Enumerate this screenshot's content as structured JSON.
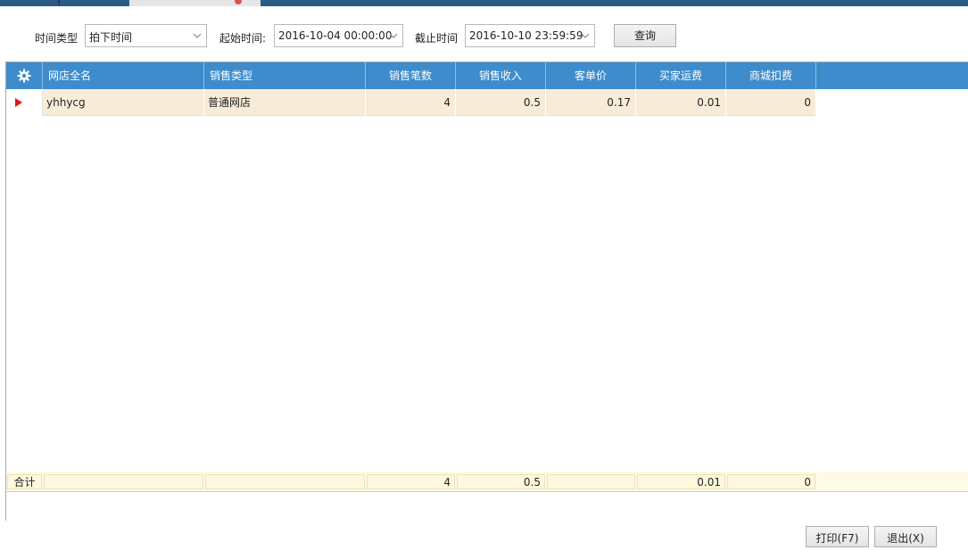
{
  "filters": {
    "time_type_label": "时间类型",
    "time_type_value": "拍下时间",
    "start_label": "起始时间:",
    "start_value": "2016-10-04 00:00:00",
    "end_label": "截止时间",
    "end_value": "2016-10-10 23:59:59",
    "query_label": "查询"
  },
  "table": {
    "columns": [
      "网店全名",
      "销售类型",
      "销售笔数",
      "销售收入",
      "客单价",
      "买家运费",
      "商城扣费"
    ],
    "rows": [
      [
        "yhhycg",
        "普通网店",
        "4",
        "0.5",
        "0.17",
        "0.01",
        "0"
      ]
    ],
    "summary": {
      "label": "合计",
      "values": [
        "",
        "",
        "4",
        "0.5",
        "",
        "0.01",
        "0"
      ]
    }
  },
  "footer": {
    "print_label": "打印(F7)",
    "exit_label": "退出(X)"
  },
  "colors": {
    "header_bg": "#3e8ccc",
    "row_bg": "#f8ecd9",
    "summary_bg": "#fdfae6",
    "row_marker": "#e01515"
  }
}
